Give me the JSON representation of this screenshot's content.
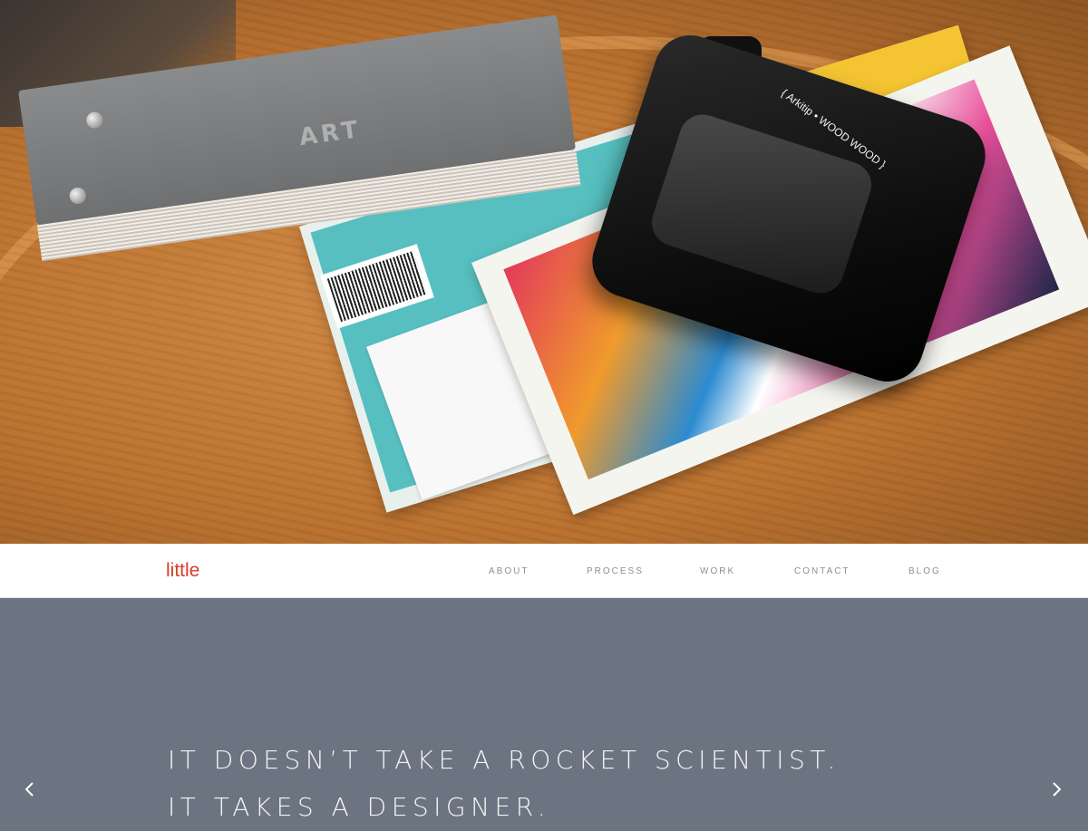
{
  "hero": {
    "book_text": "ART",
    "viewer_text": "{ Arkitip • WOOD WOOD }"
  },
  "header": {
    "logo": "little",
    "nav": [
      {
        "label": "ABOUT"
      },
      {
        "label": "PROCESS"
      },
      {
        "label": "WORK"
      },
      {
        "label": "CONTACT"
      },
      {
        "label": "BLOG"
      }
    ]
  },
  "slider": {
    "tagline_line1": "IT DOESN’T TAKE A ROCKET SCIENTIST.",
    "tagline_line2": "IT TAKES A DESIGNER.",
    "prev_icon": "chevron-left-icon",
    "next_icon": "chevron-right-icon"
  },
  "colors": {
    "brand": "#d93a2b",
    "panel": "#6b7480",
    "nav_text": "#8a8f96"
  }
}
